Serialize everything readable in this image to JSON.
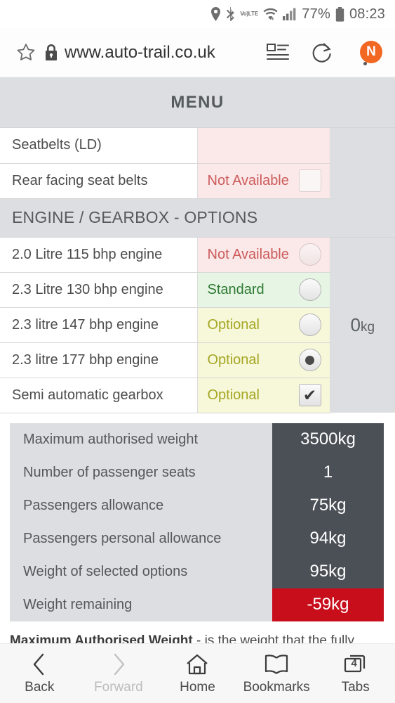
{
  "status_bar": {
    "icons": [
      "location-icon",
      "bluetooth-icon",
      "volte-icon",
      "wifi-icon",
      "signal-icon"
    ],
    "volte_top": "Vo)",
    "volte_bottom": "LTE",
    "battery_percent": "77%",
    "clock": "08:23"
  },
  "browser": {
    "url": "www.auto-trail.co.uk",
    "star_icon": "bookmark-star-icon",
    "lock_icon": "padlock-icon",
    "reader_icon": "reader-view-icon",
    "reload_icon": "reload-icon",
    "menu_icon": "overflow-menu-icon",
    "account_badge": "N"
  },
  "page": {
    "menu_label": "MENU",
    "spec_rows": [
      {
        "name": "Seatbelts (LD)",
        "status": "",
        "state": "blank",
        "control": "none",
        "checked": false,
        "kg_rowspan": false
      },
      {
        "name": "Rear facing seat belts",
        "status": "Not Available",
        "state": "na",
        "control": "checkbox",
        "checked": false
      }
    ],
    "section_header": "ENGINE / GEARBOX - OPTIONS",
    "engine_rows": [
      {
        "name": "2.0 Litre 115 bhp engine",
        "status": "Not Available",
        "state": "na",
        "control": "radio",
        "checked": false
      },
      {
        "name": "2.3 Litre 130 bhp engine",
        "status": "Standard",
        "state": "std",
        "control": "radio",
        "checked": false
      },
      {
        "name": "2.3 litre 147 bhp engine",
        "status": "Optional",
        "state": "opt",
        "control": "radio",
        "checked": false
      },
      {
        "name": "2.3 litre 177 bhp engine",
        "status": "Optional",
        "state": "opt",
        "control": "radio",
        "checked": true
      },
      {
        "name": "Semi automatic gearbox",
        "status": "Optional",
        "state": "opt",
        "control": "checkbox",
        "checked": true
      }
    ],
    "engine_weight_value": "0",
    "engine_weight_unit": "kg",
    "weight_summary": [
      {
        "label": "Maximum authorised weight",
        "value": "3500kg",
        "danger": false
      },
      {
        "label": "Number of passenger seats",
        "value": "1",
        "danger": false
      },
      {
        "label": "Passengers allowance",
        "value": "75kg",
        "danger": false
      },
      {
        "label": "Passengers personal allowance",
        "value": "94kg",
        "danger": false
      },
      {
        "label": "Weight of selected options",
        "value": "95kg",
        "danger": false
      },
      {
        "label": "Weight remaining",
        "value": "-59kg",
        "danger": true
      }
    ],
    "footnote_bold": "Maximum Authorised Weight",
    "footnote_rest": " - is the weight that the fully"
  },
  "bottom_nav": [
    {
      "label": "Back",
      "icon": "chevron-left-icon",
      "disabled": false
    },
    {
      "label": "Forward",
      "icon": "chevron-right-icon",
      "disabled": true
    },
    {
      "label": "Home",
      "icon": "home-icon",
      "disabled": false
    },
    {
      "label": "Bookmarks",
      "icon": "book-icon",
      "disabled": false
    },
    {
      "label": "Tabs",
      "icon": "tabs-icon",
      "disabled": false,
      "count": "4"
    }
  ],
  "colors": {
    "accent_orange": "#f26722",
    "danger_red": "#c80d1b",
    "dark_slate": "#4b5057",
    "chrome_gray": "#dcdee1",
    "not_available_text": "#cc5b5b",
    "standard_text": "#2f7a34",
    "optional_text": "#a5a723"
  }
}
